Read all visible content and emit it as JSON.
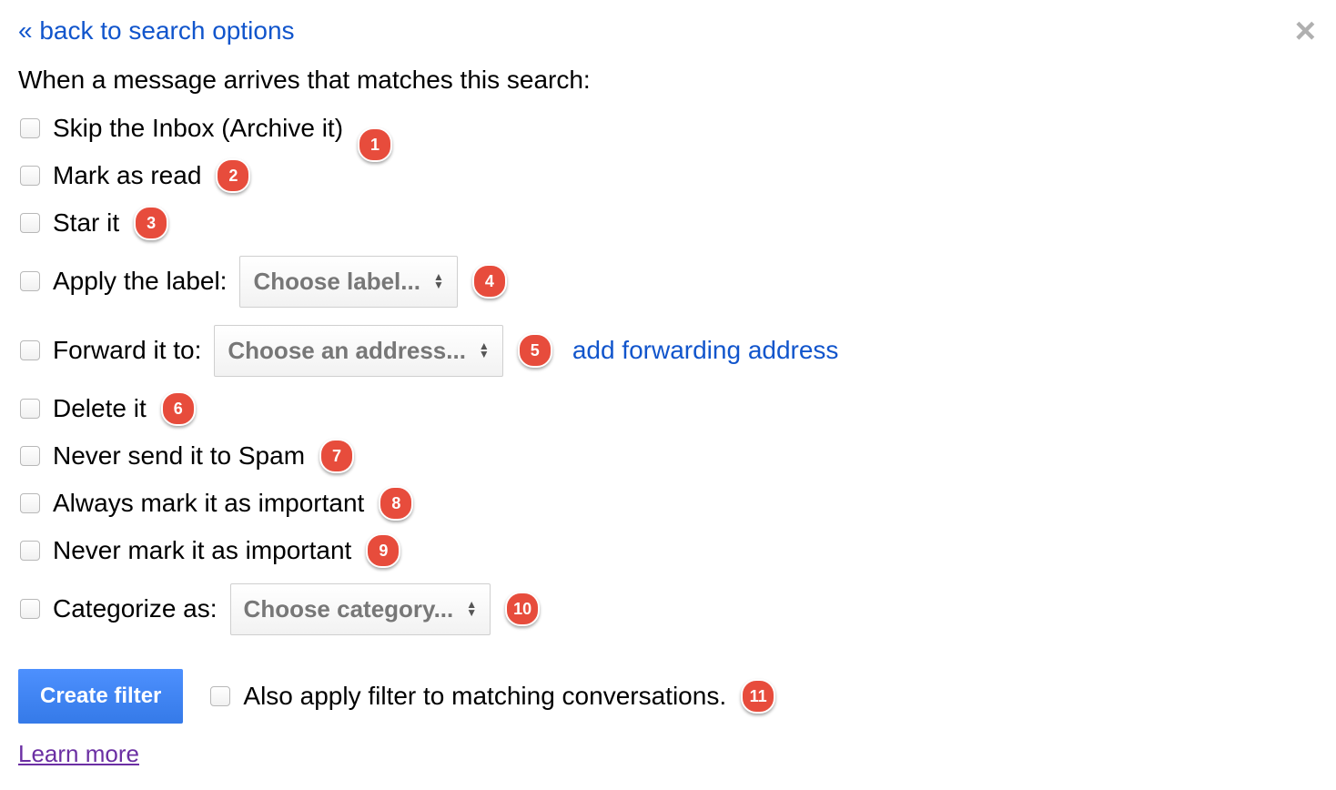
{
  "back_link": "« back to search options",
  "close_glyph": "×",
  "heading": "When a message arrives that matches this search:",
  "options": {
    "skip_inbox": "Skip the Inbox (Archive it)",
    "mark_read": "Mark as read",
    "star_it": "Star it",
    "apply_label": "Apply the label:",
    "label_select": "Choose label...",
    "forward_to": "Forward it to:",
    "forward_select": "Choose an address...",
    "add_forwarding": "add forwarding address",
    "delete_it": "Delete it",
    "never_spam": "Never send it to Spam",
    "always_important": "Always mark it as important",
    "never_important": "Never mark it as important",
    "categorize": "Categorize as:",
    "category_select": "Choose category..."
  },
  "badges": {
    "b1": "1",
    "b2": "2",
    "b3": "3",
    "b4": "4",
    "b5": "5",
    "b6": "6",
    "b7": "7",
    "b8": "8",
    "b9": "9",
    "b10": "10",
    "b11": "11"
  },
  "footer": {
    "create_button": "Create filter",
    "also_apply": "Also apply filter to matching conversations.",
    "learn_more": "Learn more"
  }
}
